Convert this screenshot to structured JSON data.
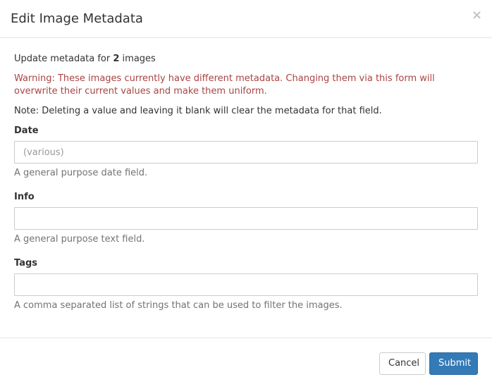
{
  "dialog": {
    "title": "Edit Image Metadata",
    "close_label": "×"
  },
  "body": {
    "intro_prefix": "Update metadata for ",
    "intro_count": "2",
    "intro_suffix": " images",
    "warning": "Warning: These images currently have different metadata. Changing them via this form will overwrite their current values and make them uniform.",
    "note": "Note: Deleting a value and leaving it blank will clear the metadata for that field."
  },
  "fields": {
    "date": {
      "label": "Date",
      "value": "",
      "placeholder": "(various)",
      "help": "A general purpose date field."
    },
    "info": {
      "label": "Info",
      "value": "",
      "placeholder": "",
      "help": "A general purpose text field."
    },
    "tags": {
      "label": "Tags",
      "value": "",
      "placeholder": "",
      "help": "A comma separated list of strings that can be used to filter the images."
    }
  },
  "footer": {
    "cancel_label": "Cancel",
    "submit_label": "Submit"
  },
  "colors": {
    "warning": "#a94442",
    "primary": "#337ab7"
  }
}
